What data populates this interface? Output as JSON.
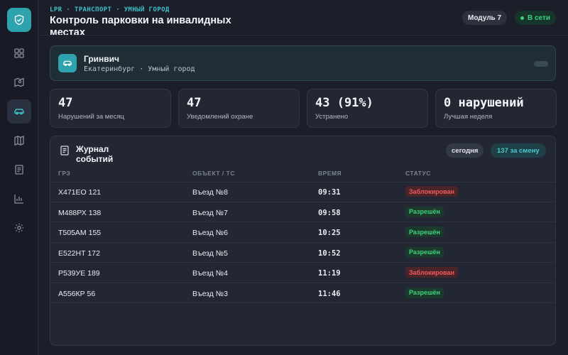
{
  "header": {
    "eyebrow": "LPR · ТРАНСПОРТ · УМНЫЙ ГОРОД",
    "title": "Контроль парковки на инвалидных местах",
    "module": "Модуль 7",
    "status": "В сети"
  },
  "sidebar": {
    "items": [
      {
        "icon": "dashboard-icon"
      },
      {
        "icon": "map-pin-icon"
      },
      {
        "icon": "car-icon",
        "active": true
      },
      {
        "icon": "map-icon"
      },
      {
        "icon": "document-icon"
      },
      {
        "icon": "chart-icon"
      },
      {
        "icon": "gear-icon"
      }
    ]
  },
  "location": {
    "name": "Гринвич",
    "subtitle": "Екатеринбург · Умный город"
  },
  "stats": [
    {
      "value": "47",
      "label": "Нарушений за месяц"
    },
    {
      "value": "47",
      "label": "Уведомлений охране"
    },
    {
      "value": "43 (91%)",
      "label": "Устранено"
    },
    {
      "value": "0 нарушений",
      "label": "Лучшая неделя"
    }
  ],
  "journal": {
    "title": "Журнал событий",
    "filter_today": "сегодня",
    "filter_shift": "137 за смену",
    "columns": [
      "ГРЗ",
      "ОБЪЕКТ / ТС",
      "ВРЕМЯ",
      "СТАТУС"
    ],
    "rows": [
      {
        "plate": "Х471ЕО 121",
        "object": "Въезд №8",
        "time": "09:31",
        "status": "Заблокирован",
        "kind": "blocked"
      },
      {
        "plate": "М488РХ 138",
        "object": "Въезд №7",
        "time": "09:58",
        "status": "Разрешён",
        "kind": "allowed"
      },
      {
        "plate": "Т505АМ 155",
        "object": "Въезд №6",
        "time": "10:25",
        "status": "Разрешён",
        "kind": "allowed"
      },
      {
        "plate": "Е522НТ 172",
        "object": "Въезд №5",
        "time": "10:52",
        "status": "Разрешён",
        "kind": "allowed"
      },
      {
        "plate": "Р539УЕ 189",
        "object": "Въезд №4",
        "time": "11:19",
        "status": "Заблокирован",
        "kind": "blocked"
      },
      {
        "plate": "А556КР 56",
        "object": "Въезд №3",
        "time": "11:46",
        "status": "Разрешён",
        "kind": "allowed"
      }
    ]
  },
  "colors": {
    "accent": "#2fa3ad",
    "success": "#3fd27f",
    "danger": "#ef5a5f",
    "background": "#1c1f2a"
  }
}
